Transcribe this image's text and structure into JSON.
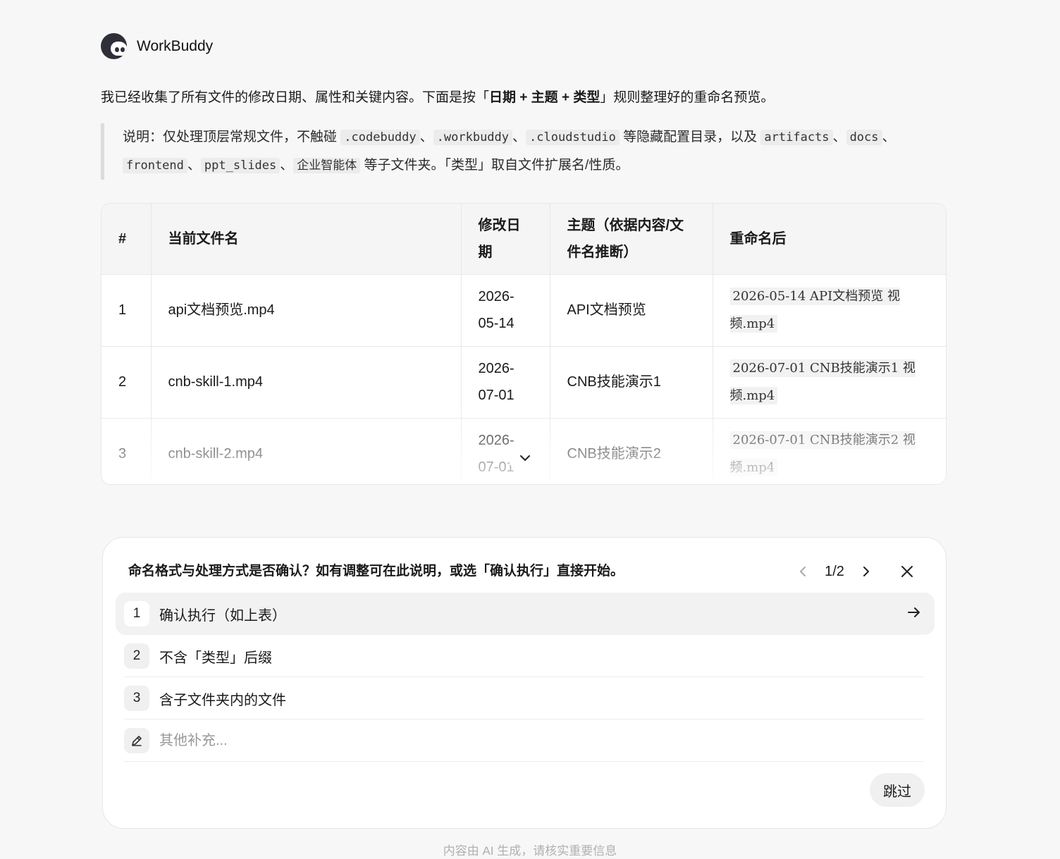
{
  "app": {
    "name": "WorkBuddy"
  },
  "message": {
    "intro_before": "我已经收集了所有文件的修改日期、属性和关键内容。下面是按「",
    "intro_rule": "日期 + 主题 + 类型",
    "intro_after": "」规则整理好的重命名预览。",
    "note": {
      "prefix": "说明：仅处理顶层常规文件，不触碰 ",
      "hidden_dirs": [
        ".codebuddy",
        ".workbuddy",
        ".cloudstudio"
      ],
      "mid1": " 等隐藏配置目录，以及 ",
      "sub_dirs": [
        "artifacts",
        "docs",
        "frontend",
        "ppt_slides",
        "企业智能体"
      ],
      "mid2": " 等子文件夹。「类型」取自文件扩展名/性质。",
      "sep": "、"
    }
  },
  "table": {
    "headers": [
      "#",
      "当前文件名",
      "修改日期",
      "主题（依据内容/文件名推断）",
      "重命名后"
    ],
    "rows": [
      {
        "no": "1",
        "current": "api文档预览.mp4",
        "date": "2026-05-14",
        "topic": "API文档预览",
        "renamed": "2026-05-14 API文档预览 视频.mp4"
      },
      {
        "no": "2",
        "current": "cnb-skill-1.mp4",
        "date": "2026-07-01",
        "topic": "CNB技能演示1",
        "renamed": "2026-07-01 CNB技能演示1 视频.mp4"
      },
      {
        "no": "3",
        "current": "cnb-skill-2.mp4",
        "date": "2026-07-01",
        "topic": "CNB技能演示2",
        "renamed": "2026-07-01 CNB技能演示2 视频.mp4"
      }
    ]
  },
  "prompt": {
    "question": "命名格式与处理方式是否确认？如有调整可在此说明，或选「确认执行」直接开始。",
    "page": "1/2",
    "options": [
      {
        "num": "1",
        "label": "确认执行（如上表）"
      },
      {
        "num": "2",
        "label": "不含「类型」后缀"
      },
      {
        "num": "3",
        "label": "含子文件夹内的文件"
      }
    ],
    "other_placeholder": "其他补充...",
    "skip_label": "跳过"
  },
  "footer": "内容由 AI 生成，请核实重要信息",
  "colors": {
    "background": "#f7f7f7",
    "panel": "#ffffff",
    "active_option": "#f2f2f2"
  }
}
